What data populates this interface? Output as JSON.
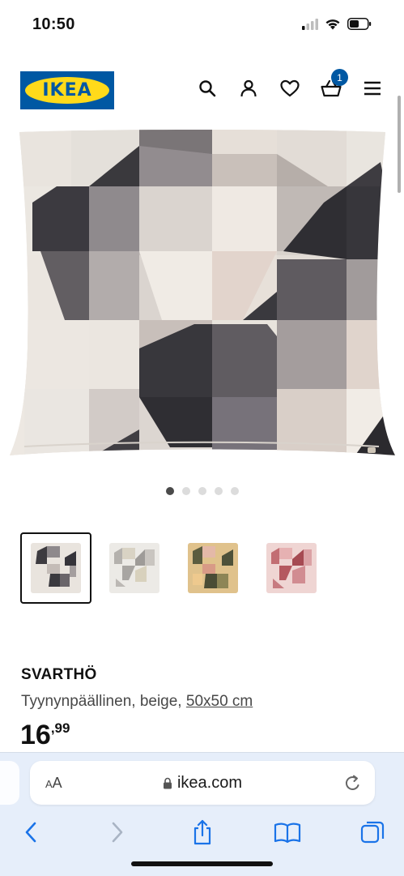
{
  "status": {
    "time": "10:50"
  },
  "header": {
    "logo_text": "IKEA",
    "brand_blue": "#0058a3",
    "brand_yellow": "#ffda1a",
    "icons": [
      "search-icon",
      "profile-icon",
      "heart-icon",
      "basket-icon",
      "menu-icon"
    ],
    "cart_count": "1"
  },
  "gallery": {
    "dot_count": 5,
    "active_dot": 1,
    "thumbnails": [
      {
        "variant": "gray",
        "selected": true
      },
      {
        "variant": "light-gray",
        "selected": false
      },
      {
        "variant": "yellow-green",
        "selected": false
      },
      {
        "variant": "pink",
        "selected": false
      }
    ]
  },
  "product": {
    "name": "SVARTHÖ",
    "description": "Tyynynpäällinen, beige, ",
    "size_link": "50x50 cm",
    "price_integer": "16",
    "price_decimal": ",99"
  },
  "browser": {
    "text_size_label_small": "A",
    "text_size_label_large": "A",
    "url": "ikea.com",
    "toolbar_icons": [
      "back-icon",
      "forward-icon",
      "share-icon",
      "bookmarks-icon",
      "tabs-icon"
    ]
  }
}
